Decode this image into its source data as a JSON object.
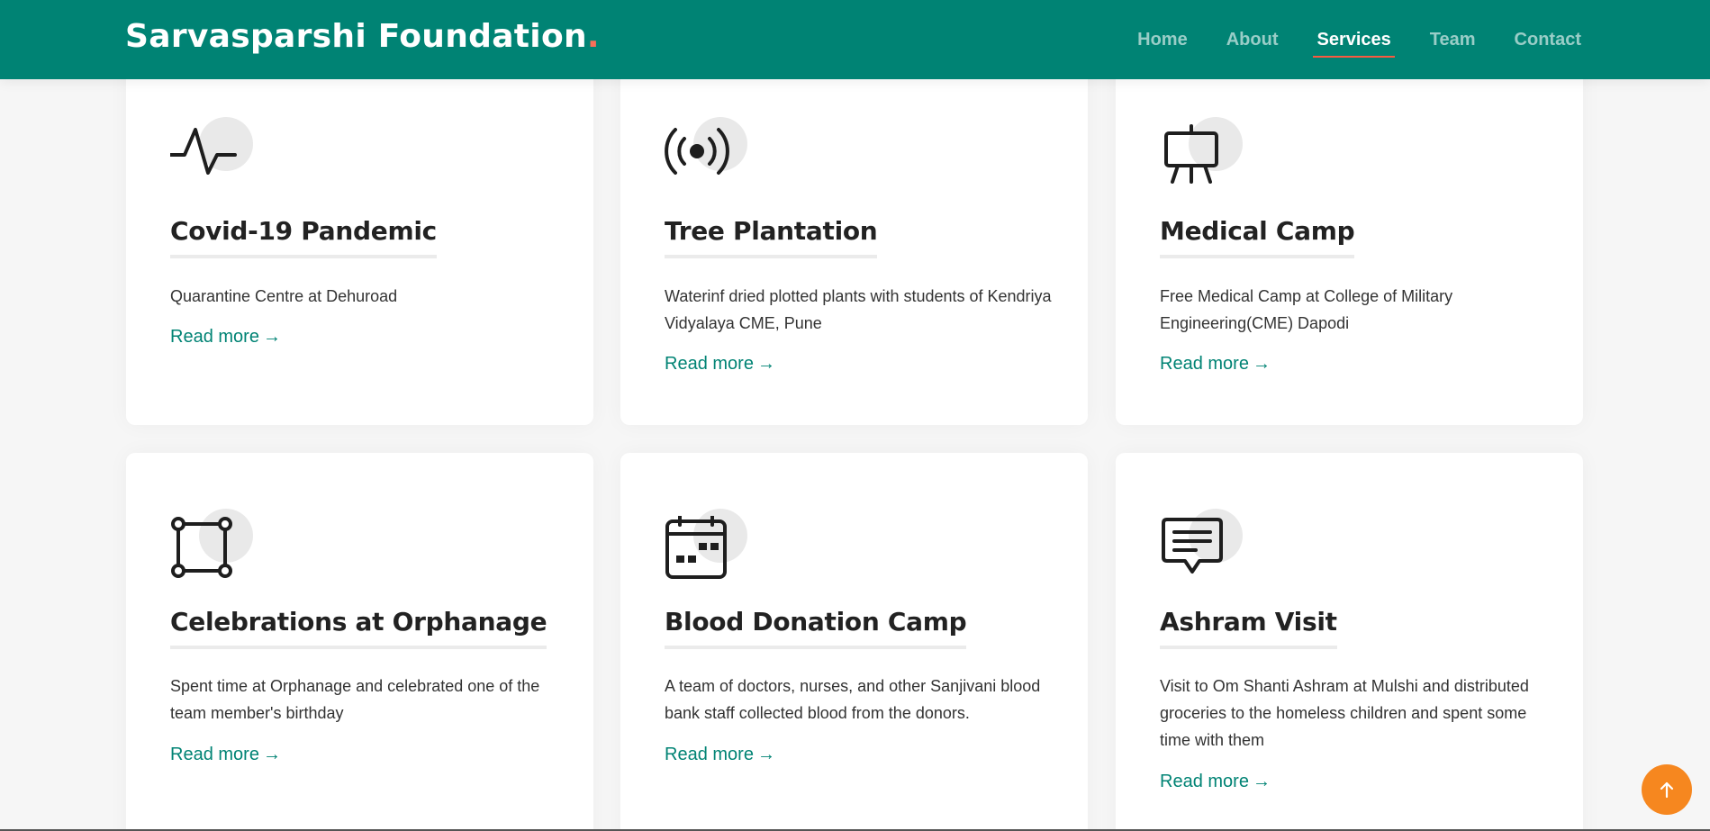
{
  "header": {
    "logo_text": "Sarvasparshi Foundation",
    "logo_dot": ".",
    "nav": [
      "Home",
      "About",
      "Services",
      "Team",
      "Contact"
    ],
    "active": "Services"
  },
  "services": [
    {
      "title": "Covid-19 Pandemic",
      "text": "Quarantine Centre at Dehuroad",
      "link": "Read more",
      "icon": "activity-icon"
    },
    {
      "title": "Tree Plantation",
      "text": "Waterinf dried plotted plants with students of Kendriya Vidyalaya CME, Pune",
      "link": "Read more",
      "icon": "broadcast-icon"
    },
    {
      "title": "Medical Camp",
      "text": "Free Medical Camp at College of Military Engineering(CME) Dapodi",
      "link": "Read more",
      "icon": "easel-icon"
    },
    {
      "title": "Celebrations at Orphanage",
      "text": "Spent time at Orphanage and celebrated one of the team member's birthday",
      "link": "Read more",
      "icon": "bounding-box-icon"
    },
    {
      "title": "Blood Donation Camp",
      "text": "A team of doctors, nurses, and other Sanjivani blood bank staff collected blood from the donors.",
      "link": "Read more",
      "icon": "calendar-icon"
    },
    {
      "title": "Ashram Visit",
      "text": "Visit to Om Shanti Ashram at Mulshi and distributed groceries to the homeless children and spent some time with them",
      "link": "Read more",
      "icon": "chat-text-icon"
    }
  ],
  "colors": {
    "header": "#008374",
    "accent": "#f85a40",
    "scroll_button": "#f6871f",
    "link": "#008374"
  }
}
